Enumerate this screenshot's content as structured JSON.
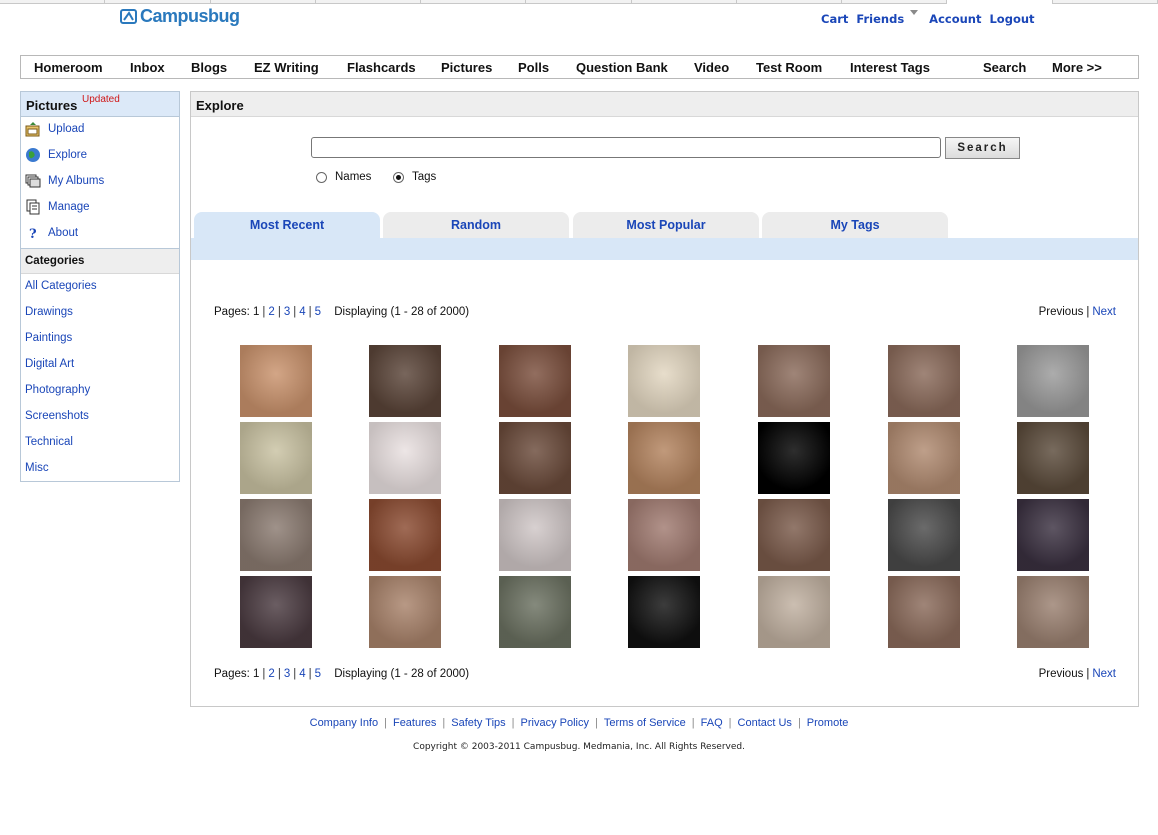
{
  "brand": {
    "name": "Campusbug",
    "color": "#2a79bd"
  },
  "user_nav": [
    {
      "label": "Cart"
    },
    {
      "label": "Friends"
    },
    {
      "label": "Account"
    },
    {
      "label": "Logout"
    }
  ],
  "main_nav": [
    "Homeroom",
    "Inbox",
    "Blogs",
    "EZ Writing",
    "Flashcards",
    "Pictures",
    "Polls",
    "Question Bank",
    "Video",
    "Test Room",
    "Interest Tags",
    "Search",
    "More >>"
  ],
  "sidebar": {
    "title": "Pictures",
    "badge": "Updated",
    "items": [
      {
        "label": "Upload",
        "icon": "upload-icon"
      },
      {
        "label": "Explore",
        "icon": "globe-icon"
      },
      {
        "label": "My Albums",
        "icon": "albums-icon"
      },
      {
        "label": "Manage",
        "icon": "manage-icon"
      },
      {
        "label": "About",
        "icon": "help-icon"
      }
    ],
    "categories_title": "Categories",
    "categories": [
      "All Categories",
      "Drawings",
      "Paintings",
      "Digital Art",
      "Photography",
      "Screenshots",
      "Technical",
      "Misc"
    ]
  },
  "explore": {
    "title": "Explore",
    "search_value": "",
    "search_button": "Search",
    "radio_names": "Names",
    "radio_tags": "Tags",
    "selected_radio": "Tags",
    "tabs": [
      "Most Recent",
      "Random",
      "Most Popular",
      "My Tags"
    ],
    "active_tab": "Most Recent",
    "pager": {
      "label": "Pages:",
      "pages": [
        "1",
        "2",
        "3",
        "4",
        "5"
      ],
      "current": "1",
      "displaying": "Displaying (1 - 28 of 2000)",
      "previous": "Previous",
      "next": "Next"
    }
  },
  "footer": {
    "links": [
      "Company Info",
      "Features",
      "Safety Tips",
      "Privacy Policy",
      "Terms of Service",
      "FAQ",
      "Contact Us",
      "Promote"
    ],
    "copyright": "Copyright © 2003-2011 Campusbug. Medmania, Inc. All Rights Reserved."
  },
  "thumbnail_colors": [
    [
      "#c9926c",
      "#5a4438",
      "#7a4e3c",
      "#e2d6c0",
      "#8a6a5a",
      "#8a6a5a",
      "#9a9a9a"
    ],
    [
      "#c9c2a2",
      "#e9e0e0",
      "#6a4a3a",
      "#b3835e",
      "#000000",
      "#b08a70",
      "#5a4a3a"
    ],
    [
      "#8a7a70",
      "#8a4a30",
      "#cfc6c6",
      "#a07a70",
      "#7a5a4a",
      "#4a4a4a",
      "#3a3040"
    ],
    [
      "#4a3a40",
      "#a8826a",
      "#6a7060",
      "#111111",
      "#c0b0a0",
      "#8a6a5a",
      "#9a8070"
    ]
  ]
}
